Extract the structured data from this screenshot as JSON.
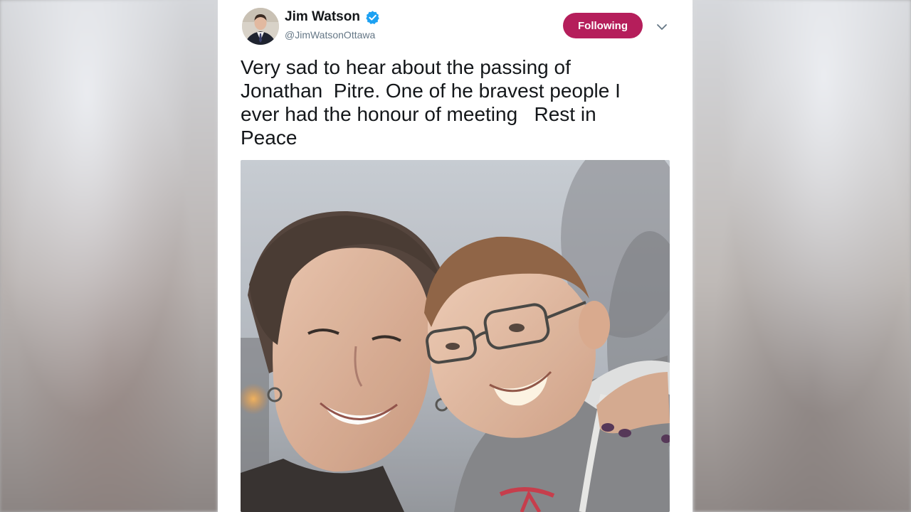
{
  "tweet": {
    "author_name": "Jim Watson",
    "author_handle": "@JimWatsonOttawa",
    "verified": true,
    "follow_button_label": "Following",
    "text": "Very sad to hear about the passing of\nJonathan  Pitre. One of he bravest people I\never had the honour of meeting   Rest in\nPeace",
    "media": {
      "subject": "newspaper-photo-woman-and-boy-with-glasses"
    }
  },
  "colors": {
    "accent": "#b51e5b",
    "verified": "#1da1f2",
    "text_primary": "#14171a",
    "text_secondary": "#657786"
  },
  "icons": {
    "verified": "verified-badge-icon",
    "menu": "chevron-down-icon"
  }
}
